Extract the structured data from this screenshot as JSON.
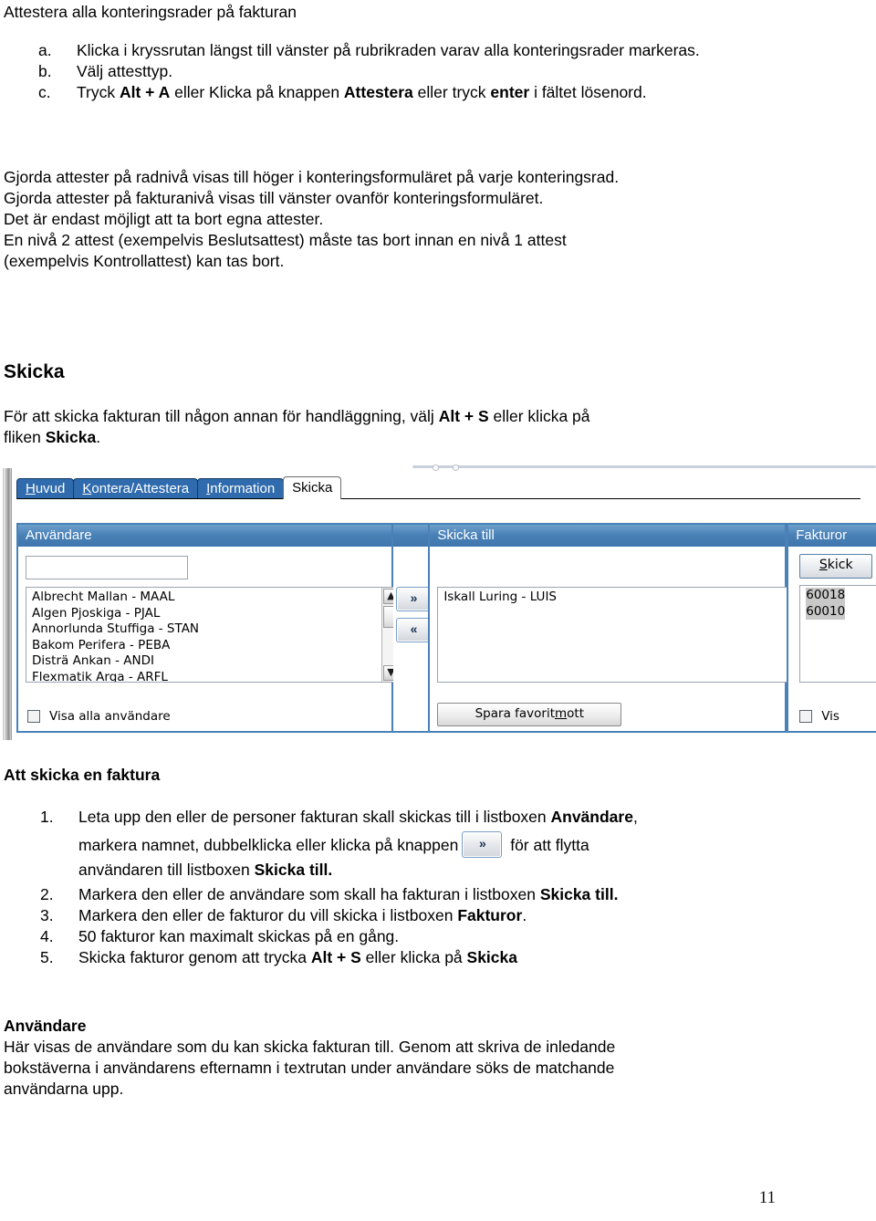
{
  "document": {
    "title": "Attestera alla konteringsrader på fakturan",
    "alpha_list": [
      {
        "marker": "a.",
        "parts": [
          {
            "t": "Klicka i kryssrutan längst till vänster på rubrikraden varav alla konteringsrader markeras.",
            "b": false
          }
        ]
      },
      {
        "marker": "b.",
        "parts": [
          {
            "t": "Välj attesttyp.",
            "b": false
          }
        ]
      },
      {
        "marker": "c.",
        "parts": [
          {
            "t": "Tryck ",
            "b": false
          },
          {
            "t": "Alt + A",
            "b": true
          },
          {
            "t": " eller Klicka på knappen ",
            "b": false
          },
          {
            "t": "Attestera",
            "b": true
          },
          {
            "t": " eller tryck ",
            "b": false
          },
          {
            "t": "enter",
            "b": true
          },
          {
            "t": " i fältet lösenord.",
            "b": false
          }
        ]
      }
    ],
    "paragraph_lines": [
      "Gjorda attester på radnivå visas till höger i konteringsformuläret på varje konteringsrad.",
      "Gjorda attester på fakturanivå visas till vänster ovanför konteringsformuläret.",
      "Det är endast möjligt att ta bort egna attester.",
      "En nivå 2 attest (exempelvis Beslutsattest) måste tas bort innan en nivå 1 attest",
      "(exempelvis Kontrollattest) kan tas bort."
    ],
    "skicka_heading": "Skicka",
    "skicka_intro_line1_a": "För att skicka fakturan till någon annan för handläggning, välj ",
    "skicka_intro_line1_b": "Alt + S",
    "skicka_intro_line1_c": " eller klicka på",
    "skicka_intro_line2_a": "fliken ",
    "skicka_intro_line2_b": "Skicka",
    "skicka_intro_line2_c": ".",
    "att_skicka_heading": "Att skicka en faktura",
    "num_list": [
      {
        "marker": "1.",
        "line1_a": "Leta upp den eller de personer fakturan skall skickas till i listboxen ",
        "line1_b": "Användare",
        "line1_c": ",",
        "line2_a": "markera namnet, dubbelklicka eller klicka på knappen ",
        "inline_button": "»",
        "line2_b": " för att flytta",
        "line3_a": "användaren till listboxen ",
        "line3_b": "Skicka till."
      },
      {
        "marker": "2.",
        "a": "Markera den eller de användare som skall ha fakturan i listboxen ",
        "b": "Skicka till.",
        "c": ""
      },
      {
        "marker": "3.",
        "a": "Markera den eller de fakturor du vill skicka i listboxen ",
        "b": "Fakturor",
        "c": "."
      },
      {
        "marker": "4.",
        "a": "50 fakturor kan maximalt skickas på en gång.",
        "b": "",
        "c": ""
      },
      {
        "marker": "5.",
        "a": "Skicka fakturor genom att trycka ",
        "b": "Alt + S",
        "c": " eller klicka på ",
        "d": "Skicka"
      }
    ],
    "anvandare_heading": "Användare",
    "anvandare_lines": [
      "Här visas de användare som du kan skicka fakturan till. Genom att skriva de inledande",
      "bokstäverna i användarens efternamn i textrutan under användare söks de matchande",
      "användarna upp."
    ],
    "page_number": "11"
  },
  "screenshot": {
    "tabs": [
      {
        "pre": "",
        "accel": "H",
        "post": "uvud",
        "active": false
      },
      {
        "pre": "",
        "accel": "K",
        "post": "ontera/Attestera",
        "active": false
      },
      {
        "pre": "",
        "accel": "I",
        "post": "nformation",
        "active": false
      },
      {
        "pre": "",
        "accel": "",
        "post": "Skicka",
        "active": true
      }
    ],
    "panel_users": {
      "header": "Användare",
      "search_value": "",
      "search_placeholder": "",
      "items": [
        "Albrecht Mallan - MAAL",
        "Algen Pjoskiga - PJAL",
        "Annorlunda Stuffiga - STAN",
        "Bakom Perifera - PEBA",
        "Disträ Ankan - ANDI",
        "Flexmatik Arga - ARFL"
      ],
      "checkbox_label": "Visa alla användare",
      "checkbox_checked": false
    },
    "move_buttons": {
      "forward": "»",
      "back": "«"
    },
    "panel_send_to": {
      "header": "Skicka till",
      "items": [
        "Iskall Luring - LUIS"
      ],
      "save_button_pre": "Spara favorit",
      "save_button_accel": "m",
      "save_button_post": "ott"
    },
    "panel_invoices": {
      "header": "Fakturor",
      "send_button_accel": "S",
      "send_button_post": "kick",
      "items": [
        "60018",
        "60010"
      ],
      "checkbox_label": "Vis",
      "checkbox_checked": false
    },
    "colors": {
      "panel_blue": "#4a82b8",
      "tab_blue": "#2f6bad",
      "selection_gray": "#c8c8c8"
    }
  }
}
